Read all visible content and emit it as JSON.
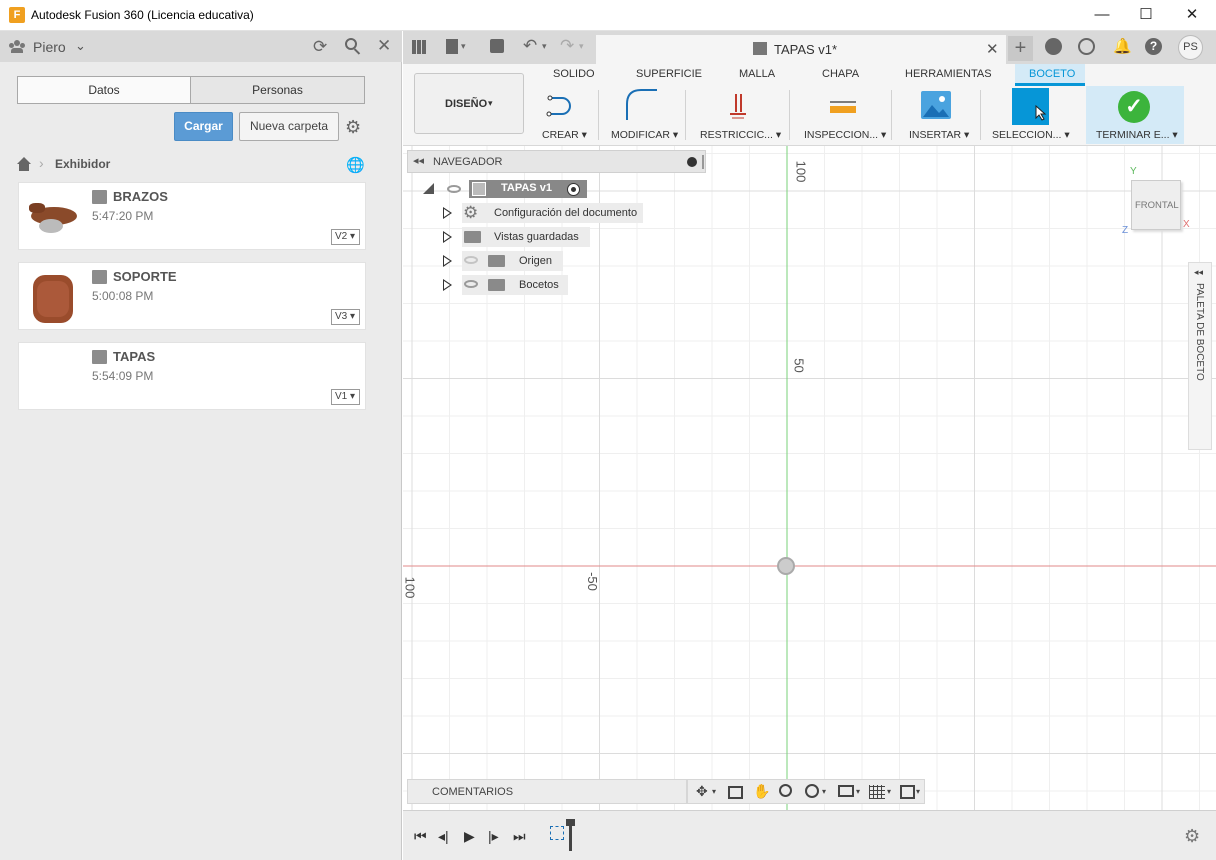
{
  "window": {
    "title": "Autodesk Fusion 360 (Licencia educativa)",
    "app_icon_letter": "F"
  },
  "left_panel": {
    "user_name": "Piero",
    "segments": [
      "Datos",
      "Personas"
    ],
    "upload_label": "Cargar",
    "new_folder_label": "Nueva carpeta",
    "breadcrumb_folder": "Exhibidor",
    "files": [
      {
        "name": "BRAZOS",
        "time": "5:47:20 PM",
        "version": "V2"
      },
      {
        "name": "SOPORTE",
        "time": "5:00:08 PM",
        "version": "V3"
      },
      {
        "name": "TAPAS",
        "time": "5:54:09 PM",
        "version": "V1"
      }
    ]
  },
  "doc_tab": {
    "title": "TAPAS v1*",
    "user_initials": "PS"
  },
  "ribbon": {
    "workspace": "DISEÑO",
    "tabs": [
      "SOLIDO",
      "SUPERFICIE",
      "MALLA",
      "CHAPA",
      "HERRAMIENTAS",
      "BOCETO"
    ],
    "active_tab": "BOCETO",
    "groups": [
      "CREAR",
      "MODIFICAR",
      "RESTRICCIC...",
      "INSPECCION...",
      "INSERTAR",
      "SELECCION...",
      "TERMINAR E..."
    ],
    "accent_color": "#0696d7",
    "finish_color": "#3cb43c"
  },
  "navigator": {
    "header": "NAVEGADOR",
    "root": "TAPAS v1",
    "items": [
      "Configuración del documento",
      "Vistas guardadas",
      "Origen",
      "Bocetos"
    ]
  },
  "canvas": {
    "axis_labels": [
      "100",
      "50",
      "-50",
      "100"
    ],
    "viewcube_label": "FRONTAL",
    "viewcube_axes": [
      "Y",
      "X",
      "Z"
    ],
    "side_palette": "PALETA DE BOCETO"
  },
  "comments": {
    "label": "COMENTARIOS"
  }
}
